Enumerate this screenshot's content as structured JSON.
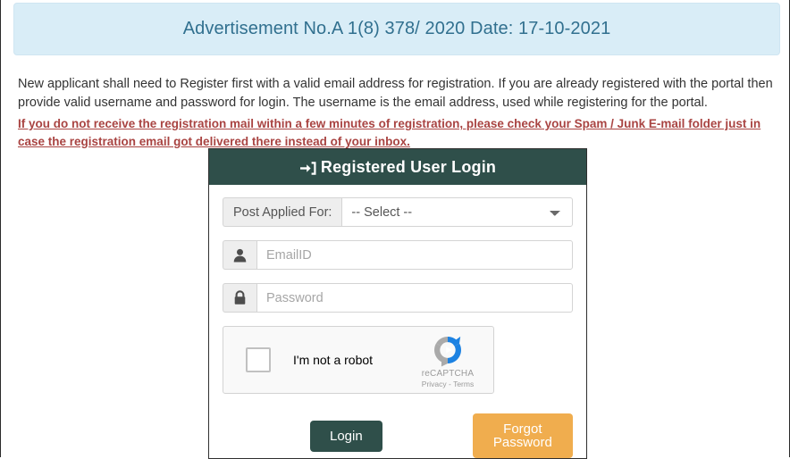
{
  "banner": {
    "text": "Advertisement No.A 1(8) 378/ 2020 Date: 17-10-2021",
    "bg_color": "#d9edf7",
    "text_color": "#31708f"
  },
  "instructions": {
    "paragraph": "New applicant shall need to Register first with a valid email address for registration. If you are already registered with the portal then provide valid username and password for login. The username is the email address, used while registering for the portal.",
    "warning": "If you do not receive the registration mail within a few minutes of registration, please check your Spam / Junk E-mail folder just in case the registration email got delivered there instead of your inbox.",
    "warning_color": "#a94442"
  },
  "login_panel": {
    "header": {
      "title": "Registered User Login",
      "icon": "sign-in-icon",
      "bg_color": "#2f4f4a"
    },
    "post_applied": {
      "label": "Post Applied For:",
      "selected": "-- Select --",
      "options": [
        "-- Select --"
      ],
      "icon": "chevron-down-icon"
    },
    "email": {
      "placeholder": "EmailID",
      "value": "",
      "icon": "user-icon"
    },
    "password": {
      "placeholder": "Password",
      "value": "",
      "icon": "lock-icon"
    },
    "recaptcha": {
      "label": "I'm not a robot",
      "brand": "reCAPTCHA",
      "links": "Privacy - Terms",
      "checked": false,
      "logo_icon": "recaptcha-logo-icon"
    },
    "buttons": {
      "login": "Login",
      "login_color": "#2f4f4a",
      "forgot": "Forgot Password",
      "forgot_color": "#f0ad4e"
    }
  }
}
